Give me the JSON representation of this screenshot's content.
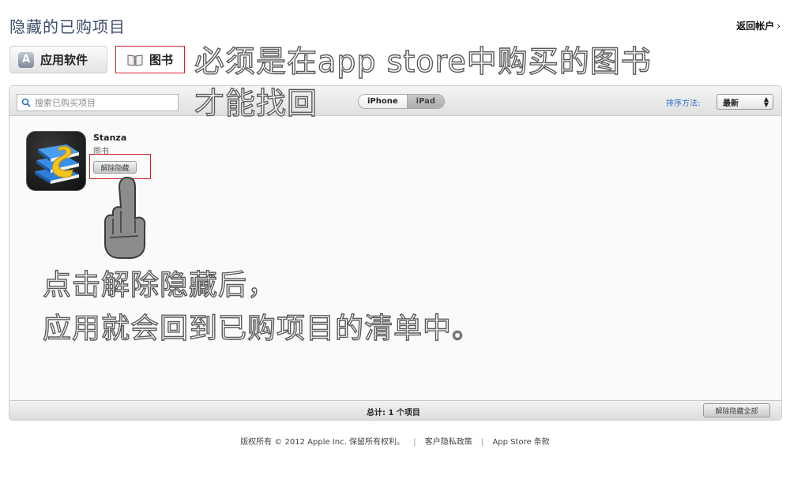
{
  "header": {
    "title": "隐藏的已购项目",
    "back_link": "返回帐户",
    "back_chevron": "›"
  },
  "type_tabs": [
    {
      "label": "应用软件",
      "icon": "app-store-icon"
    },
    {
      "label": "图书",
      "icon": "book-icon"
    }
  ],
  "overlays": {
    "top_line1": "必须是在app store中购买的图书",
    "top_line2": "才能找回",
    "bottom_line1": "点击解除隐藏后，",
    "bottom_line2": "应用就会回到已购项目的清单中。"
  },
  "toolbar": {
    "search_placeholder": "搜索已购买项目",
    "devices": [
      "iPhone",
      "iPad"
    ],
    "sort_label": "排序方法:",
    "sort_value": "最新"
  },
  "items": [
    {
      "title": "Stanza",
      "kind": "图书",
      "unhide_label": "解除隐藏"
    }
  ],
  "footer_bar": {
    "total": "总计: 1 个项目",
    "unhide_all": "解除隐藏全部"
  },
  "copyright": {
    "text": "版权所有 © 2012 Apple Inc. 保留所有权利。",
    "privacy": "客户隐私政策",
    "terms": "App Store 条款"
  },
  "colors": {
    "title_blue": "#3d4e6e",
    "link_blue": "#2e6fc2",
    "highlight_red": "#d0202a"
  }
}
